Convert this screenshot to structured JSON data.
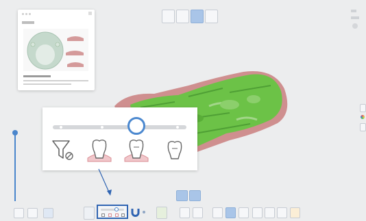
{
  "colors": {
    "background": "#ecedee",
    "mesh_green": "#6cc247",
    "gum_pink": "#cf8f8f",
    "selection_blue": "#2f64b2",
    "slider_track": "#d5d7da",
    "slider_knob": "#4b88cf",
    "preview_green": "#c9dccf"
  },
  "icons": [
    "funnel-slash-icon",
    "tooth-with-gum-icon",
    "tooth-with-gum-icon",
    "tooth-outline-icon",
    "magnet-icon"
  ],
  "filter_slider": {
    "stop_count": 4,
    "selected_stop": 3
  }
}
